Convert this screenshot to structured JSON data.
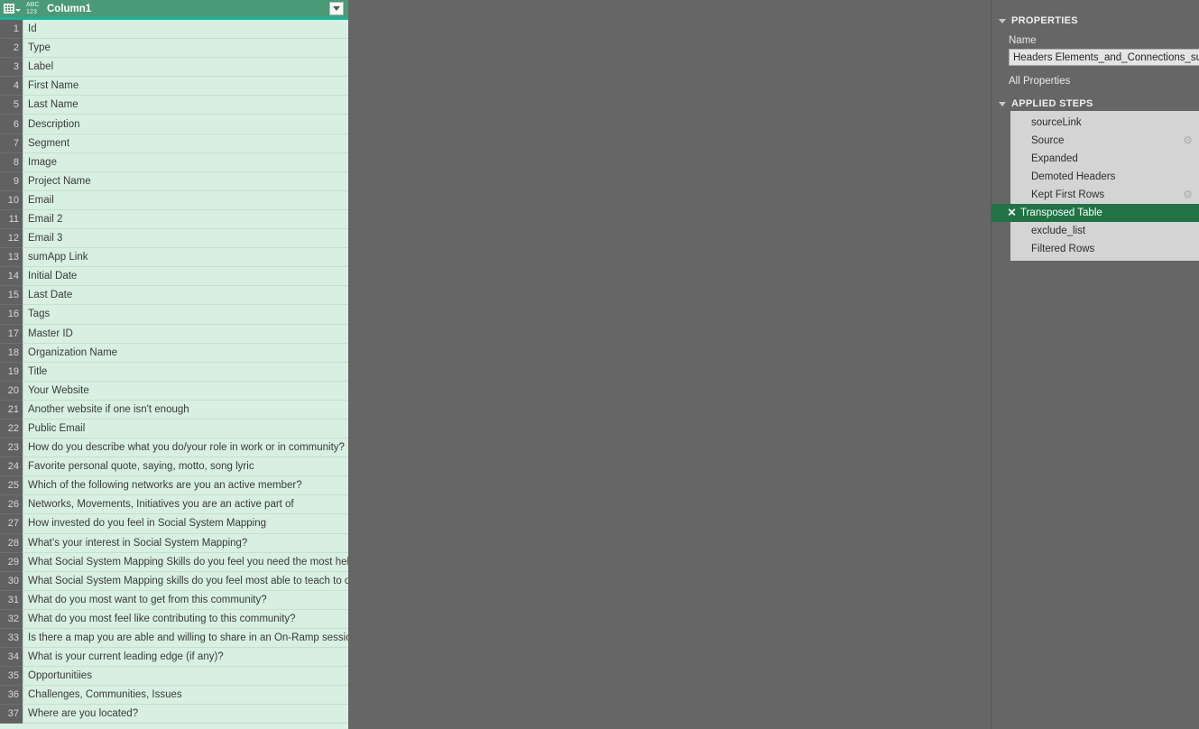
{
  "grid": {
    "corner_icon": "table-icon",
    "type_icon": "abc123-type-icon",
    "type_icon_top": "ABC",
    "type_icon_bottom": "123",
    "column_header": "Column1",
    "filter_icon": "chevron-down-icon",
    "row_numbers": [
      1,
      2,
      3,
      4,
      5,
      6,
      7,
      8,
      9,
      10,
      11,
      12,
      13,
      14,
      15,
      16,
      17,
      18,
      19,
      20,
      21,
      22,
      23,
      24,
      25,
      26,
      27,
      28,
      29,
      30,
      31,
      32,
      33,
      34,
      35,
      36,
      37
    ],
    "values": [
      "Id",
      "Type",
      "Label",
      "First Name",
      "Last Name",
      "Description",
      "Segment",
      "Image",
      "Project Name",
      "Email",
      "Email 2",
      "Email 3",
      "sumApp Link",
      "Initial Date",
      "Last Date",
      "Tags",
      "Master ID",
      "Organization Name",
      "Title",
      "Your Website",
      "Another website if one isn't enough",
      "Public Email",
      "How do you describe what you do/your role in work or in community?",
      "Favorite personal quote, saying, motto, song lyric",
      "Which of the following networks are you an active member?",
      "Networks, Movements, Initiatives you are an active part of",
      "How invested do you feel in Social System Mapping",
      "What’s your interest in Social System Mapping?",
      "What Social System Mapping Skills do you feel you need the most help…",
      "What Social System Mapping skills do you feel most able to teach to ot…",
      "What do you most want to get from this community?",
      "What do you most feel like contributing to this community?",
      "Is there a map you are able and willing to share in an On-Ramp session?",
      "What is your current leading edge (if any)?",
      "Opportunitiies",
      "Challenges, Communities, Issues",
      "Where are you located?"
    ]
  },
  "query_settings": {
    "properties": {
      "section_title": "PROPERTIES",
      "expand_icon": "triangle-collapse-icon",
      "name_label": "Name",
      "name_value": "Headers Elements_and_Connections_sum",
      "all_properties_link": "All Properties"
    },
    "applied_steps": {
      "section_title": "APPLIED STEPS",
      "expand_icon": "triangle-collapse-icon",
      "steps": [
        {
          "label": "sourceLink",
          "gear": false,
          "selected": false
        },
        {
          "label": "Source",
          "gear": true,
          "selected": false
        },
        {
          "label": "Expanded",
          "gear": false,
          "selected": false
        },
        {
          "label": "Demoted Headers",
          "gear": false,
          "selected": false
        },
        {
          "label": "Kept First Rows",
          "gear": true,
          "selected": false
        },
        {
          "label": "Transposed Table",
          "gear": false,
          "selected": true
        },
        {
          "label": "exclude_list",
          "gear": false,
          "selected": false
        },
        {
          "label": "Filtered Rows",
          "gear": false,
          "selected": false
        }
      ],
      "delete_icon": "x-delete-step-icon",
      "gear_icon": "gear-settings-icon"
    }
  },
  "colors": {
    "header_green": "#4a9a77",
    "header_underline_teal": "#16b5a0",
    "cell_mint": "#d7f0e2",
    "rownum_gray": "#616161",
    "canvas_gray": "#666666",
    "steps_panel_gray": "#d4d4d4",
    "selected_step_green": "#217346"
  }
}
